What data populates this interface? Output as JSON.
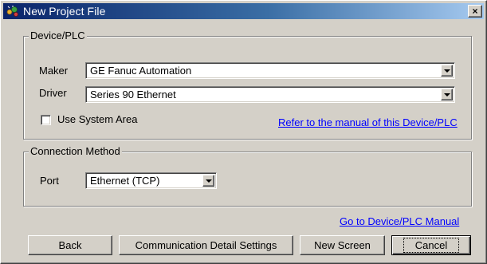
{
  "window": {
    "title": "New Project File",
    "close_glyph": "×",
    "icon": "new-project-icon"
  },
  "device_group": {
    "label": "Device/PLC",
    "maker_label": "Maker",
    "maker_value": "GE Fanuc Automation",
    "driver_label": "Driver",
    "driver_value": "Series 90 Ethernet",
    "use_system_area_label": "Use System Area",
    "use_system_area_checked": false,
    "manual_link": "Refer to the manual of this Device/PLC"
  },
  "connection_group": {
    "label": "Connection Method",
    "port_label": "Port",
    "port_value": "Ethernet (TCP)"
  },
  "footer": {
    "manual_link": "Go to Device/PLC Manual",
    "back_label": "Back",
    "comm_label": "Communication Detail Settings",
    "new_screen_label": "New Screen",
    "cancel_label": "Cancel"
  },
  "colors": {
    "face": "#d4d0c8",
    "title_start": "#0a246a",
    "title_end": "#a6caf0",
    "link": "#0000ff"
  }
}
